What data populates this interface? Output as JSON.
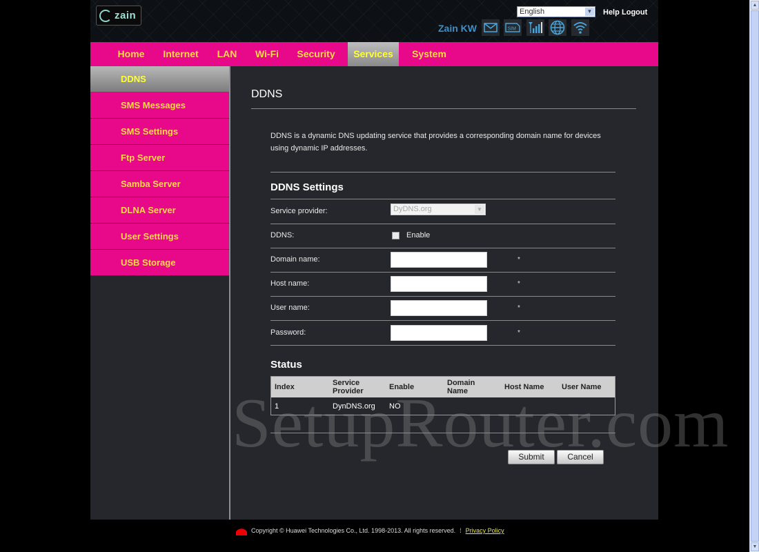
{
  "header": {
    "logo_text": "zain",
    "language": "English",
    "help_label": "Help",
    "logout_label": "Logout",
    "operator": "Zain KW",
    "status_icons": [
      "mail-icon",
      "sim-icon",
      "signal-icon",
      "globe-icon",
      "wifi-icon"
    ],
    "sim_text": "SIM"
  },
  "nav": {
    "items": [
      {
        "label": "Home"
      },
      {
        "label": "Internet"
      },
      {
        "label": "LAN"
      },
      {
        "label": "Wi-Fi"
      },
      {
        "label": "Security"
      },
      {
        "label": "Services",
        "active": true
      },
      {
        "label": "System"
      }
    ]
  },
  "sidebar": {
    "items": [
      {
        "label": "DDNS",
        "active": true
      },
      {
        "label": "SMS Messages"
      },
      {
        "label": "SMS Settings"
      },
      {
        "label": "Ftp Server"
      },
      {
        "label": "Samba Server"
      },
      {
        "label": "DLNA Server"
      },
      {
        "label": "User Settings"
      },
      {
        "label": "USB Storage"
      }
    ]
  },
  "main": {
    "title": "DDNS",
    "description": "DDNS is a dynamic DNS updating service that provides a corresponding domain name for devices using dynamic IP addresses.",
    "settings_title": "DDNS Settings",
    "service_provider_label": "Service provider:",
    "service_provider_value": "DyDNS.org",
    "ddns_label": "DDNS:",
    "enable_label": "Enable",
    "enable_checked": false,
    "domain_label": "Domain name:",
    "domain_value": "",
    "host_label": "Host name:",
    "host_value": "",
    "user_label": "User name:",
    "user_value": "",
    "password_label": "Password:",
    "password_value": "",
    "required_mark": "*",
    "status_title": "Status",
    "status_table": {
      "headers": [
        "Index",
        "Service Provider",
        "Enable",
        "Domain Name",
        "Host Name",
        "User Name"
      ],
      "rows": [
        [
          "1",
          "DynDNS.org",
          "NO",
          "",
          "",
          ""
        ]
      ]
    },
    "submit_label": "Submit",
    "cancel_label": "Cancel"
  },
  "watermark": "SetupRouter.com",
  "footer": {
    "copyright": "Copyright © Huawei Technologies Co., Ltd. 1998-2013. All rights reserved.",
    "separator": "⁞",
    "privacy_label": "Privacy Policy"
  },
  "colors": {
    "accent": "#e8088a",
    "nav_text": "#ffd84a",
    "operator": "#3d8fc9",
    "panel": "#26272c"
  }
}
